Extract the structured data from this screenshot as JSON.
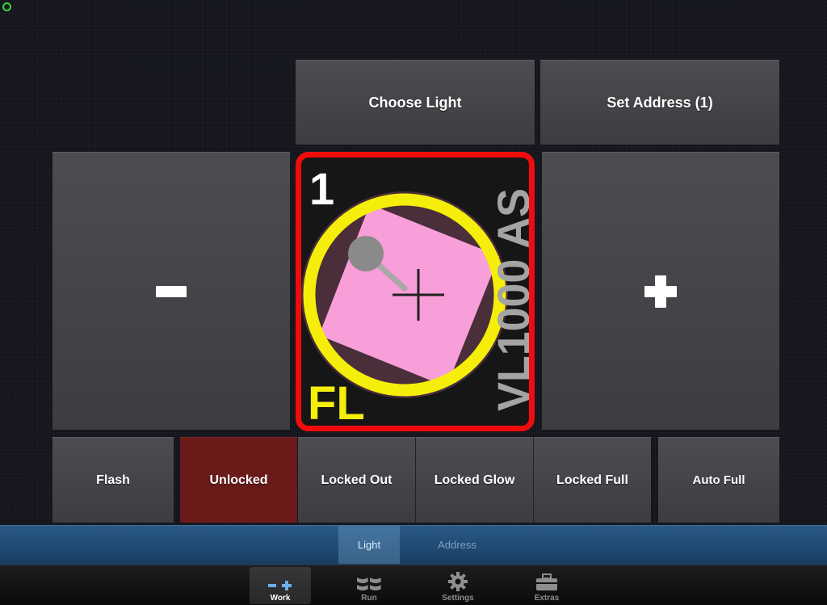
{
  "top_buttons": {
    "choose_light": "Choose Light",
    "set_address": "Set Address (1)"
  },
  "light": {
    "number": "1",
    "model": "VL1000 AS",
    "type": "FL",
    "ring_color": "#f5ee0a",
    "frame_color": "#f00c0c",
    "beam_color": "#f89ed8"
  },
  "mode_buttons": {
    "flash": "Flash",
    "unlocked": "Unlocked",
    "locked_out": "Locked Out",
    "locked_glow": "Locked Glow",
    "locked_full": "Locked Full",
    "auto_full": "Auto Full",
    "active": "Unlocked"
  },
  "segments": {
    "light": "Light",
    "address": "Address",
    "selected": "Light"
  },
  "tabs": {
    "work": "Work",
    "run": "Run",
    "settings": "Settings",
    "extras": "Extras",
    "selected": "Work"
  },
  "icons": {
    "status": "status-ring-icon",
    "minus": "minus-icon",
    "plus": "plus-icon",
    "work": "work-icon",
    "run": "run-icon",
    "settings": "gear-icon",
    "extras": "toolbox-icon"
  }
}
